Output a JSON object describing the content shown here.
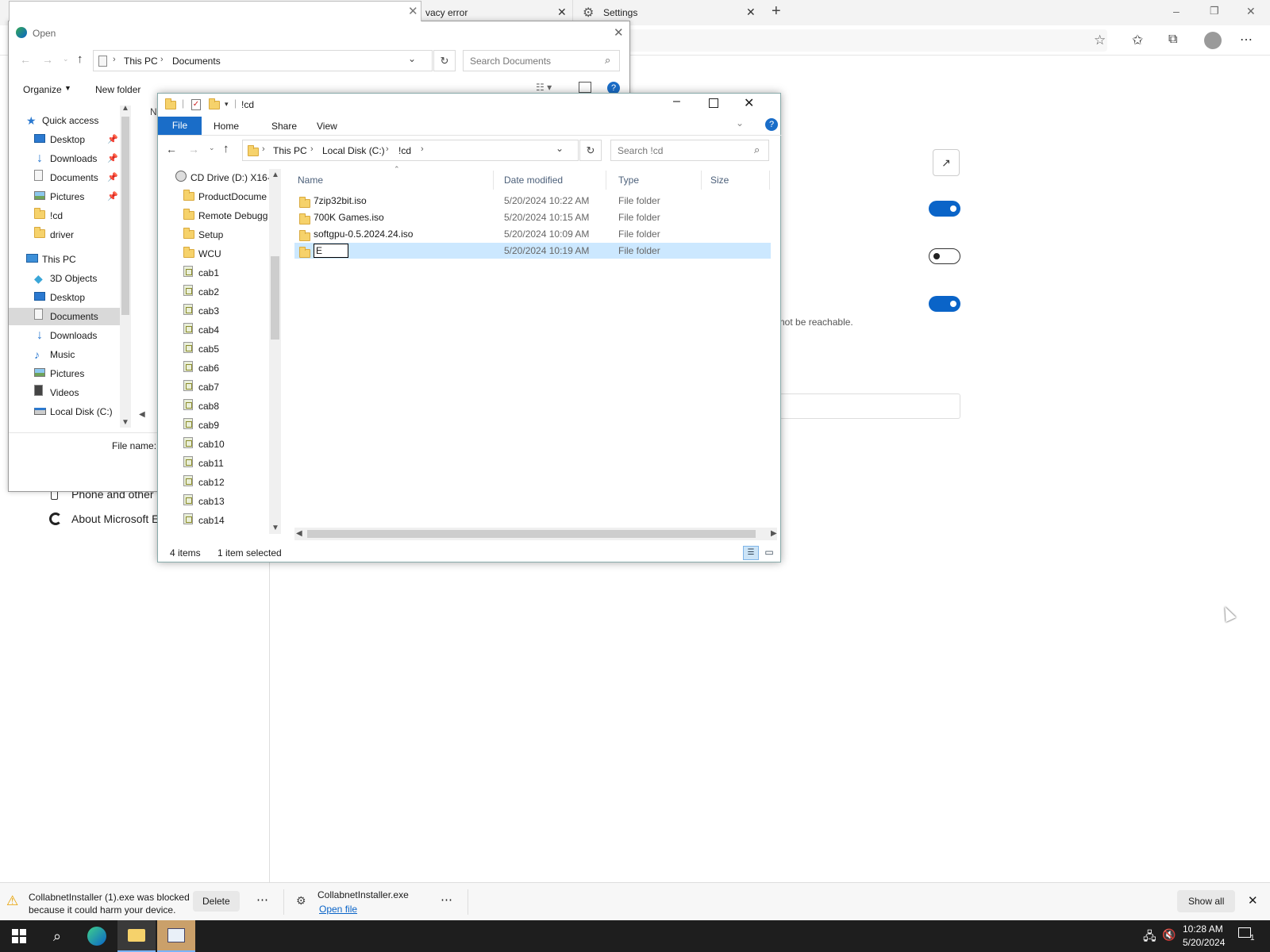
{
  "browser": {
    "tabs": [
      {
        "label": "vacy error"
      },
      {
        "label": "Settings"
      }
    ],
    "new_tab_symbol": "+",
    "window_controls": {
      "minimize": "–",
      "restore": "❐",
      "close": "✕"
    }
  },
  "settings_page": {
    "not_reachable_text": "not be reachable.",
    "toggles": [
      {
        "state": "on"
      },
      {
        "state": "off"
      },
      {
        "state": "on"
      }
    ],
    "left_nav": [
      {
        "label": "Phone and other",
        "icon": "phone-icon"
      },
      {
        "label": "About Microsoft E",
        "icon": "edge-icon"
      }
    ]
  },
  "open_dialog": {
    "title": "Open",
    "breadcrumb": [
      "This PC",
      "Documents"
    ],
    "search_placeholder": "Search Documents",
    "organize_label": "Organize",
    "new_folder_label": "New folder",
    "column_hint": "N",
    "file_name_label": "File name:",
    "nav": [
      {
        "label": "Quick access",
        "icon": "star-icon",
        "level": 0
      },
      {
        "label": "Desktop",
        "icon": "desktop-icon",
        "level": 1,
        "pinned": true
      },
      {
        "label": "Downloads",
        "icon": "download-icon",
        "level": 1,
        "pinned": true
      },
      {
        "label": "Documents",
        "icon": "document-icon",
        "level": 1,
        "pinned": true
      },
      {
        "label": "Pictures",
        "icon": "pictures-icon",
        "level": 1,
        "pinned": true
      },
      {
        "label": "!cd",
        "icon": "folder-icon",
        "level": 1,
        "pinned": false
      },
      {
        "label": "driver",
        "icon": "folder-icon",
        "level": 1,
        "pinned": false
      },
      {
        "label": "This PC",
        "icon": "computer-icon",
        "level": 0
      },
      {
        "label": "3D Objects",
        "icon": "3d-objects-icon",
        "level": 1
      },
      {
        "label": "Desktop",
        "icon": "desktop-icon",
        "level": 1
      },
      {
        "label": "Documents",
        "icon": "document-icon",
        "level": 1,
        "selected": true
      },
      {
        "label": "Downloads",
        "icon": "download-icon",
        "level": 1
      },
      {
        "label": "Music",
        "icon": "music-icon",
        "level": 1
      },
      {
        "label": "Pictures",
        "icon": "pictures-icon",
        "level": 1
      },
      {
        "label": "Videos",
        "icon": "videos-icon",
        "level": 1
      },
      {
        "label": "Local Disk (C:)",
        "icon": "drive-icon",
        "level": 1
      }
    ]
  },
  "explorer": {
    "title": "!cd",
    "ribbon_tabs": [
      "File",
      "Home",
      "Share",
      "View"
    ],
    "breadcrumb": [
      "This PC",
      "Local Disk (C:)",
      "!cd"
    ],
    "search_placeholder": "Search !cd",
    "columns": {
      "name": "Name",
      "date": "Date modified",
      "type": "Type",
      "size": "Size"
    },
    "files": [
      {
        "name": "7zip32bit.iso",
        "date": "5/20/2024 10:22 AM",
        "type": "File folder",
        "selected": false
      },
      {
        "name": "700K Games.iso",
        "date": "5/20/2024 10:15 AM",
        "type": "File folder",
        "selected": false
      },
      {
        "name": "softgpu-0.5.2024.24.iso",
        "date": "5/20/2024 10:09 AM",
        "type": "File folder",
        "selected": false
      },
      {
        "name": "E",
        "date": "5/20/2024 10:19 AM",
        "type": "File folder",
        "selected": true,
        "renaming": true
      }
    ],
    "tree": [
      {
        "label": "CD Drive (D:) X16-",
        "icon": "cd-drive-icon"
      },
      {
        "label": "ProductDocume",
        "icon": "folder-icon"
      },
      {
        "label": "Remote Debugg",
        "icon": "folder-icon"
      },
      {
        "label": "Setup",
        "icon": "folder-icon"
      },
      {
        "label": "WCU",
        "icon": "folder-icon"
      },
      {
        "label": "cab1",
        "icon": "cab-icon"
      },
      {
        "label": "cab2",
        "icon": "cab-icon"
      },
      {
        "label": "cab3",
        "icon": "cab-icon"
      },
      {
        "label": "cab4",
        "icon": "cab-icon"
      },
      {
        "label": "cab5",
        "icon": "cab-icon"
      },
      {
        "label": "cab6",
        "icon": "cab-icon"
      },
      {
        "label": "cab7",
        "icon": "cab-icon"
      },
      {
        "label": "cab8",
        "icon": "cab-icon"
      },
      {
        "label": "cab9",
        "icon": "cab-icon"
      },
      {
        "label": "cab10",
        "icon": "cab-icon"
      },
      {
        "label": "cab11",
        "icon": "cab-icon"
      },
      {
        "label": "cab12",
        "icon": "cab-icon"
      },
      {
        "label": "cab13",
        "icon": "cab-icon"
      },
      {
        "label": "cab14",
        "icon": "cab-icon"
      }
    ],
    "status_items": "4 items",
    "status_selected": "1 item selected"
  },
  "download_bar": {
    "item1_line1": "CollabnetInstaller (1).exe was blocked",
    "item1_line2": "because it could harm your device.",
    "delete_label": "Delete",
    "more_label": "⋯",
    "item2_name": "CollabnetInstaller.exe",
    "item2_link": "Open file",
    "show_all_label": "Show all"
  },
  "taskbar": {
    "time": "10:28 AM",
    "date": "5/20/2024",
    "notification_count": "1"
  },
  "colors": {
    "accent": "#0a64c8",
    "selection": "#cce8ff",
    "ribbon_file": "#1a6dc8",
    "taskbar": "#1e1e1e"
  }
}
